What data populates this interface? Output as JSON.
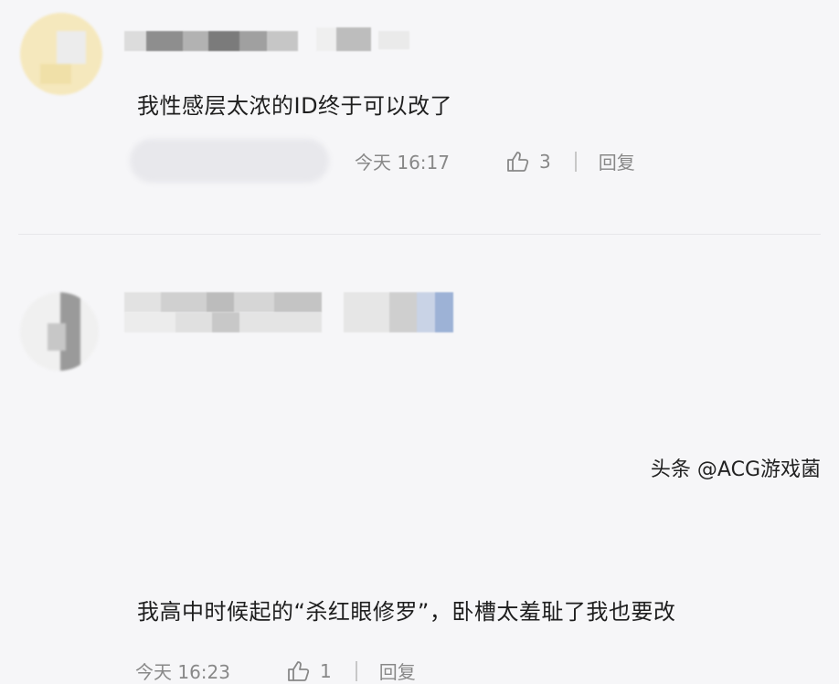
{
  "comments": [
    {
      "text": "我性感层太浓的ID终于可以改了",
      "time": "今天 16:17",
      "likes": "3",
      "reply_label": "回复"
    },
    {
      "text": "我高中时候起的“杀红眼修罗”，卧槽太羞耻了我也要改",
      "time": "今天 16:23",
      "likes": "1",
      "reply_label": "回复"
    }
  ],
  "watermark": "头条 @ACG游戏菌",
  "icons": {
    "like": "thumbs-up-icon"
  },
  "colors": {
    "background": "#f6f6f8",
    "text": "#1e1e1e",
    "meta": "#888888"
  }
}
